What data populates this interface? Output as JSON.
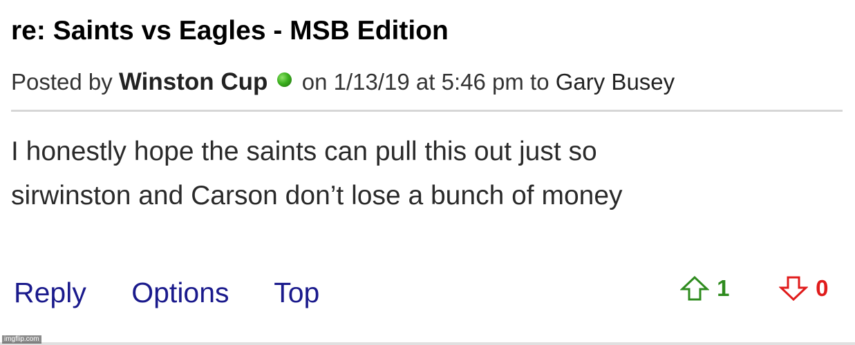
{
  "post": {
    "title": "re: Saints vs Eagles - MSB Edition",
    "posted_by_label": "Posted by",
    "author": "Winston Cup",
    "on_label": "on",
    "date": "1/13/19",
    "at_label": "at",
    "time": "5:46 pm",
    "to_label": "to",
    "reply_to": "Gary Busey",
    "body_line1": "I honestly hope the saints can pull this out just so",
    "body_line2": "sirwinston and Carson don’t lose a bunch of money"
  },
  "actions": {
    "reply": "Reply",
    "options": "Options",
    "top": "Top"
  },
  "votes": {
    "up": "1",
    "down": "0",
    "up_color": "#2e8b1e",
    "down_color": "#e01b1b"
  },
  "icons": {
    "status": "online-status-icon",
    "upvote": "upvote-arrow-icon",
    "downvote": "downvote-arrow-icon"
  },
  "watermark": "imgflip.com"
}
